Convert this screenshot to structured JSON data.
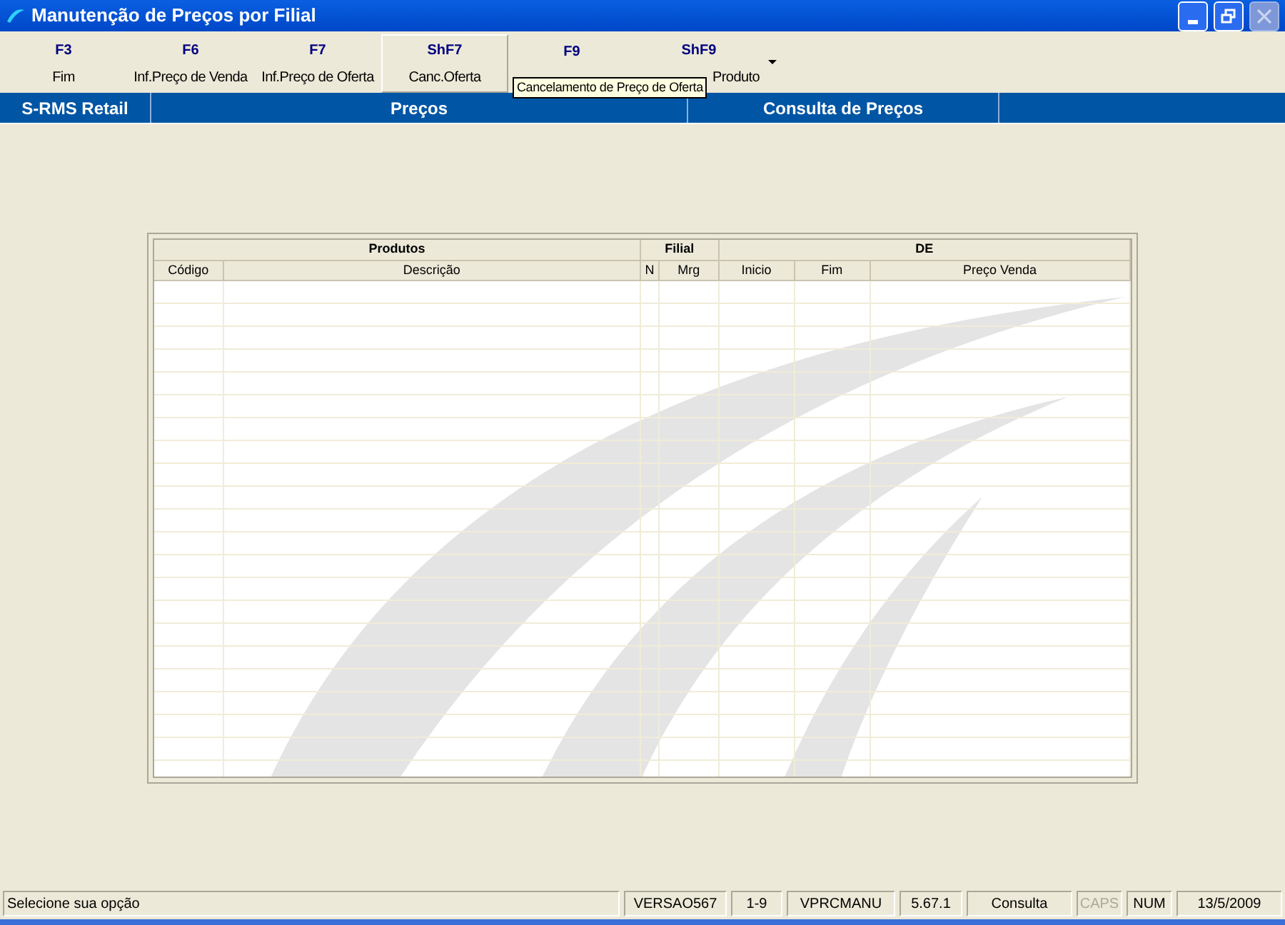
{
  "window": {
    "title": "Manutenção de Preços por Filial"
  },
  "toolbar": [
    {
      "key": "F3",
      "label": "Fim",
      "hovered": false
    },
    {
      "key": "F6",
      "label": "Inf.Preço de Venda",
      "hovered": false
    },
    {
      "key": "F7",
      "label": "Inf.Preço de Oferta",
      "hovered": false
    },
    {
      "key": "ShF7",
      "label": "Canc.Oferta",
      "hovered": true
    },
    {
      "key": "F9",
      "hovered": false
    },
    {
      "key": "ShF9",
      "label": "Produto",
      "hovered": false
    }
  ],
  "tooltip": "Cancelamento de Preço de Oferta",
  "nav": [
    "S-RMS Retail",
    "Preços",
    "Consulta de Preços"
  ],
  "table": {
    "groups": [
      {
        "label": "Produtos"
      },
      {
        "label": "Filial"
      },
      {
        "label": "DE"
      }
    ],
    "columns": [
      "Código",
      "Descrição",
      "N",
      "Mrg",
      "Inicio",
      "Fim",
      "Preço Venda"
    ]
  },
  "status_bar": [
    {
      "text": "Selecione sua opção",
      "enabled": true
    },
    {
      "text": "VERSAO567",
      "enabled": true
    },
    {
      "text": "1-9",
      "enabled": true
    },
    {
      "text": "VPRCMANU",
      "enabled": true
    },
    {
      "text": "5.67.1",
      "enabled": true
    },
    {
      "text": "Consulta",
      "enabled": true
    },
    {
      "text": "CAPS",
      "enabled": false
    },
    {
      "text": "NUM",
      "enabled": true
    },
    {
      "text": "13/5/2009",
      "enabled": true
    }
  ]
}
